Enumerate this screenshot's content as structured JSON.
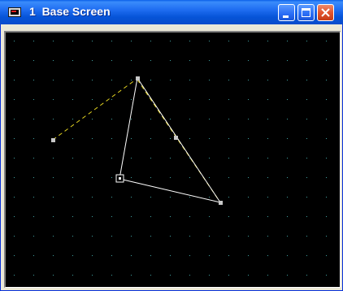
{
  "window": {
    "title": "1  Base Screen",
    "icon": "screen-icon"
  },
  "titlebar_buttons": [
    {
      "name": "minimize",
      "icon": "minimize-icon"
    },
    {
      "name": "maximize",
      "icon": "maximize-icon"
    },
    {
      "name": "close",
      "icon": "close-icon"
    }
  ],
  "colors": {
    "canvas_background": "#000000",
    "grid_dot": "#40a0a0",
    "shape_line": "#ffffff",
    "guide_line": "#e0d020",
    "handle_fill": "#c8c8c8"
  }
}
